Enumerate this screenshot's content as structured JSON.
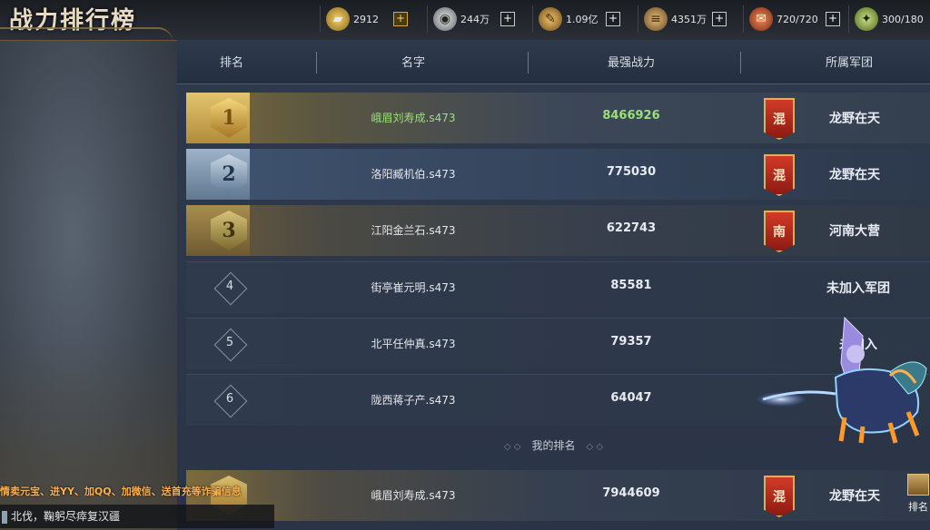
{
  "header": {
    "title": "战力排行榜",
    "resources": [
      {
        "icon": "gold-ingot-icon",
        "value": "2912",
        "plus": "+"
      },
      {
        "icon": "coin-icon",
        "value": "244万",
        "plus": "+"
      },
      {
        "icon": "feather-icon",
        "value": "1.09亿",
        "plus": "+"
      },
      {
        "icon": "wood-icon",
        "value": "4351万",
        "plus": "+"
      },
      {
        "icon": "scroll-icon",
        "value": "720/720",
        "plus": "+"
      },
      {
        "icon": "stamina-icon",
        "value": "300/180"
      }
    ]
  },
  "table": {
    "columns": {
      "rank": "排名",
      "name": "名字",
      "power": "最强战力",
      "legion": "所属军团"
    },
    "rows": [
      {
        "rank": "1",
        "name": "峨眉刘寿成.s473",
        "power": "8466926",
        "legion_badge": "混",
        "legion": "龙野在天"
      },
      {
        "rank": "2",
        "name": "洛阳臧机伯.s473",
        "power": "775030",
        "legion_badge": "混",
        "legion": "龙野在天"
      },
      {
        "rank": "3",
        "name": "江阳金兰石.s473",
        "power": "622743",
        "legion_badge": "南",
        "legion": "河南大营"
      },
      {
        "rank": "4",
        "name": "街亭崔元明.s473",
        "power": "85581",
        "legion": "未加入军团"
      },
      {
        "rank": "5",
        "name": "北平任仲真.s473",
        "power": "79357",
        "legion": "未加入"
      },
      {
        "rank": "6",
        "name": "陇西蒋子产.s473",
        "power": "64047",
        "legion": "未"
      }
    ],
    "my_rank_label": "我的排名",
    "my_row": {
      "name": "峨眉刘寿成.s473",
      "power": "7944609",
      "legion_badge": "混",
      "legion": "龙野在天"
    }
  },
  "bottom": {
    "scroll_warning": "情卖元宝、进YY、加QQ、加微信、送首充等诈骗信息",
    "chat_line": "北伐，鞠躬尽瘁复汉疆",
    "side_button_label": "排名"
  },
  "colors": {
    "accent_gold": "#d3a642",
    "top_rank_text": "#9be07a",
    "banner_red": "#d23a28",
    "warning_text": "#ffb04a"
  }
}
